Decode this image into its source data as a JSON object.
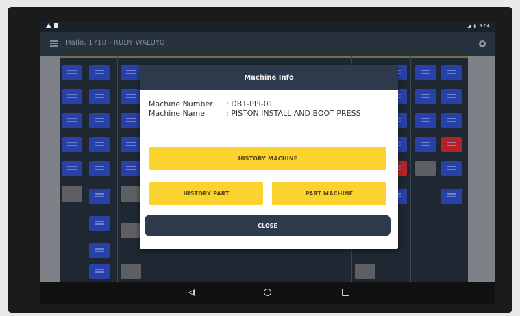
{
  "status": {
    "time": "9:04"
  },
  "appbar": {
    "title": "Hallo, 1710 - RUDY WALUYO"
  },
  "dialog": {
    "title": "Machine Info",
    "machine_number_label": "Machine Number",
    "machine_number_value": ": DB1-PPI-01",
    "machine_name_label": "Machine Name",
    "machine_name_value": ": PISTON INSTALL AND BOOT PRESS",
    "history_machine_label": "HISTORY MACHINE",
    "history_part_label": "HISTORY PART",
    "part_machine_label": "PART MACHINE",
    "close_label": "CLOSE"
  },
  "colors": {
    "accent": "#fcd22e",
    "header": "#2c3a4b",
    "tile": "#2741a8",
    "tile_alert": "#b4232a"
  },
  "icons": [
    "menu-icon",
    "settings-icon",
    "nav-back-icon",
    "nav-home-icon",
    "nav-recent-icon"
  ]
}
